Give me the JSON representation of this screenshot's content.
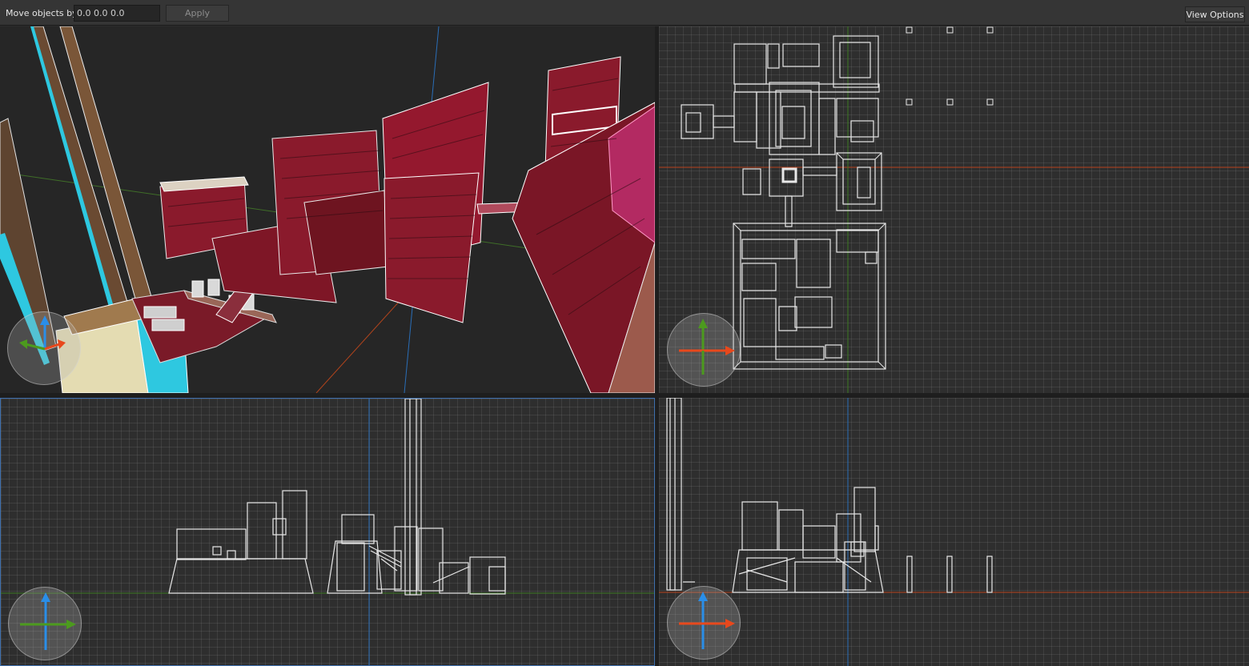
{
  "toolbar": {
    "move_label": "Move objects by",
    "move_value": "0.0 0.0 0.0",
    "apply_label": "Apply",
    "view_options_label": "View Options"
  },
  "viewports": [
    {
      "name": "perspective",
      "gizmo_axes": [
        "blue-up",
        "green-left",
        "red-right"
      ]
    },
    {
      "name": "top",
      "gizmo_axes": [
        "green-up",
        "red-right"
      ]
    },
    {
      "name": "front",
      "gizmo_axes": [
        "blue-up",
        "green-right"
      ]
    },
    {
      "name": "side",
      "gizmo_axes": [
        "blue-up",
        "red-right"
      ]
    }
  ],
  "colors": {
    "x_axis": "#e8481c",
    "y_axis": "#4c9a1e",
    "z_axis": "#2a8ee8",
    "selection_border": "#3d6fae",
    "wall_texture": "#8a1a2c"
  }
}
